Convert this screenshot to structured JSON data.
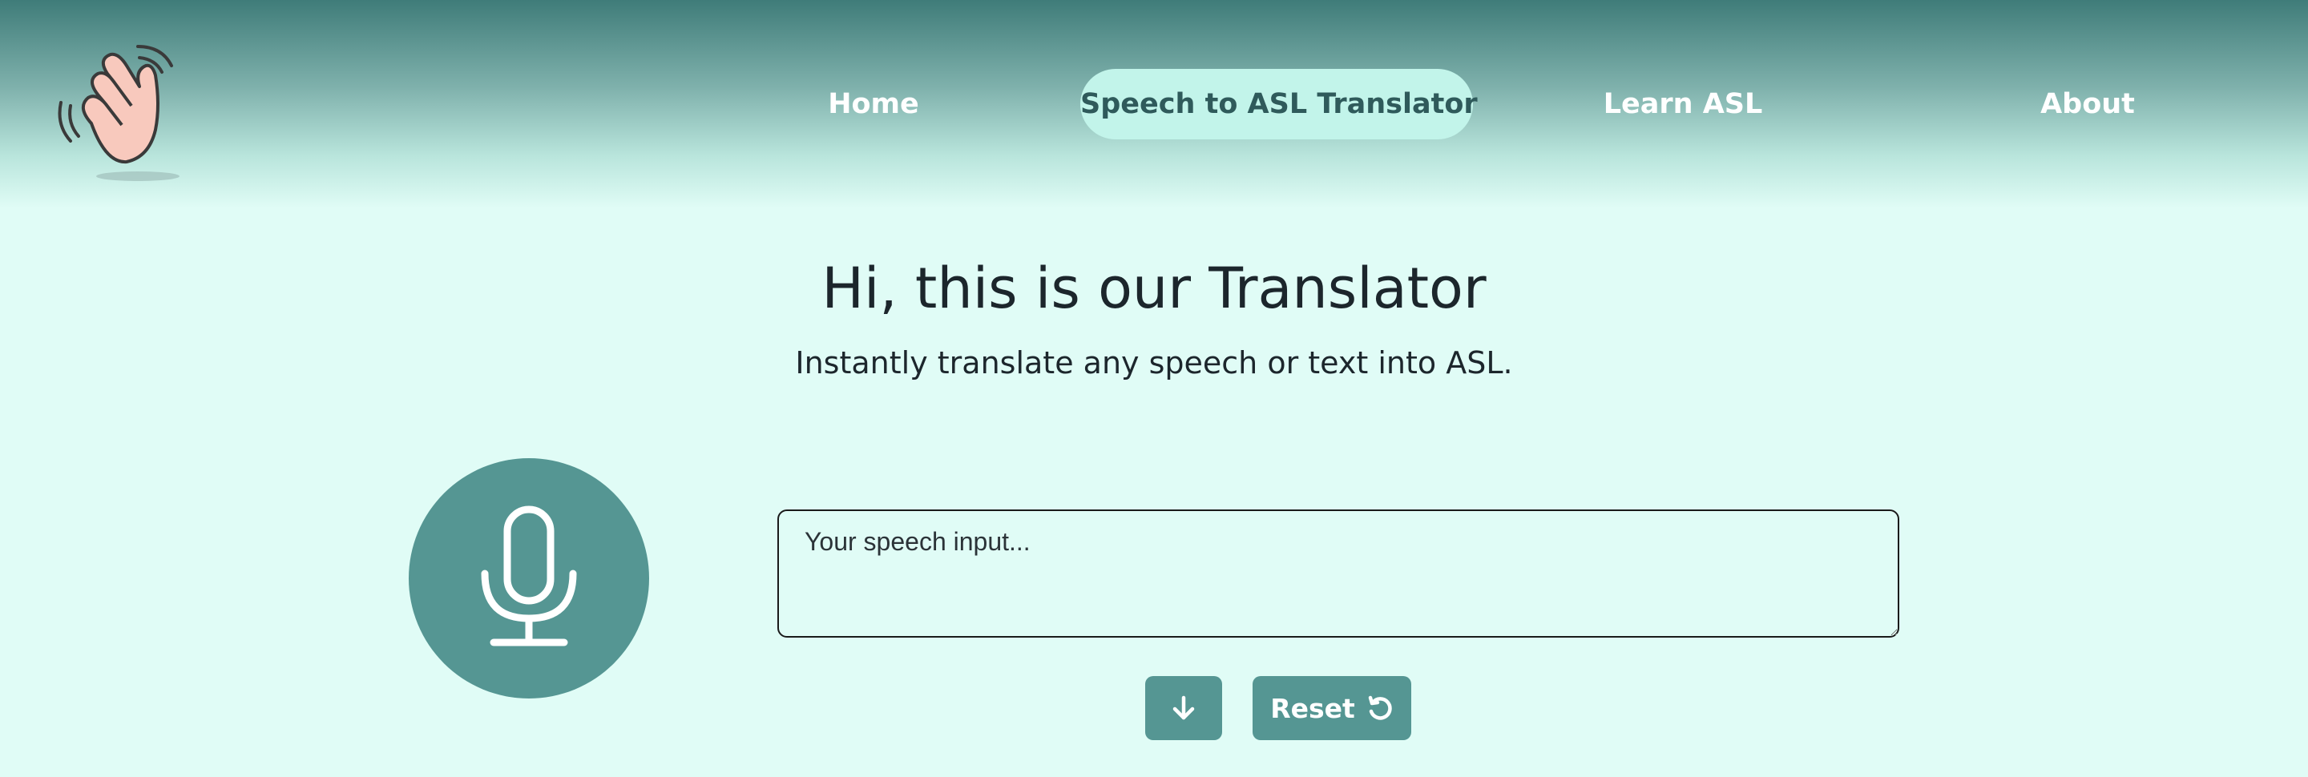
{
  "logo": {
    "icon": "waving-hand-icon"
  },
  "nav": {
    "items": [
      {
        "label": "Home",
        "active": false
      },
      {
        "label": "Speech to ASL Translator",
        "active": true
      },
      {
        "label": "Learn ASL",
        "active": false
      },
      {
        "label": "About",
        "active": false
      }
    ]
  },
  "main": {
    "title": "Hi, this is our Translator",
    "subtitle": "Instantly translate any speech or text into ASL."
  },
  "mic": {
    "icon": "microphone-icon"
  },
  "speech_input": {
    "value": "",
    "placeholder": "Your speech input..."
  },
  "actions": {
    "translate_icon": "arrow-down-icon",
    "reset_label": "Reset",
    "reset_icon": "rotate-ccw-icon"
  },
  "colors": {
    "background": "#e0fcf6",
    "nav_gradient_top": "#3f7c79",
    "nav_active_bg": "#c2f4ea",
    "nav_active_text": "#2f5a5b",
    "accent": "#559693"
  }
}
